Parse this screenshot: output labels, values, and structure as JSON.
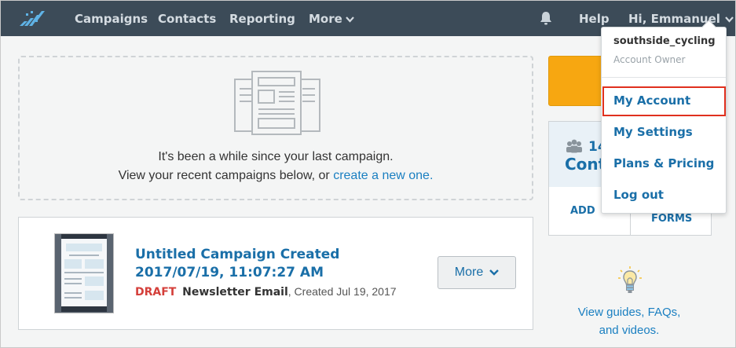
{
  "nav": {
    "items": [
      {
        "label": "Campaigns"
      },
      {
        "label": "Contacts"
      },
      {
        "label": "Reporting"
      },
      {
        "label": "More"
      }
    ],
    "help_label": "Help",
    "user_greeting": "Hi, Emmanuel"
  },
  "empty_state": {
    "line1": "It's been a while since your last campaign.",
    "line2_prefix": "View your recent campaigns below, or ",
    "line2_link": "create a new one."
  },
  "campaign": {
    "title": "Untitled Campaign Created 2017/07/19, 11:07:27 AM",
    "status": "DRAFT",
    "type": "Newsletter Email",
    "created": ", Created Jul 19, 2017",
    "more_label": "More"
  },
  "contacts_card": {
    "count": "14",
    "label": "Cont",
    "add_label": "ADD",
    "forms_label": "FORMS"
  },
  "guides": {
    "line1": "View guides, FAQs,",
    "line2": "and videos."
  },
  "account_menu": {
    "username": "southside_cycling",
    "role": "Account Owner",
    "items": [
      {
        "label": "My Account",
        "highlighted": true
      },
      {
        "label": "My Settings"
      },
      {
        "label": "Plans & Pricing"
      },
      {
        "label": "Log out"
      }
    ]
  },
  "colors": {
    "nav_bg": "#3c4b58",
    "link_blue": "#1a6fa8",
    "draft_red": "#d43f3a",
    "accent_orange": "#f7a711",
    "highlight_red": "#e0301e"
  },
  "icons": [
    "brand-logo-icon",
    "chevron-down-icon",
    "bell-icon",
    "campaign-illustration-icon",
    "people-icon",
    "lightbulb-icon"
  ]
}
